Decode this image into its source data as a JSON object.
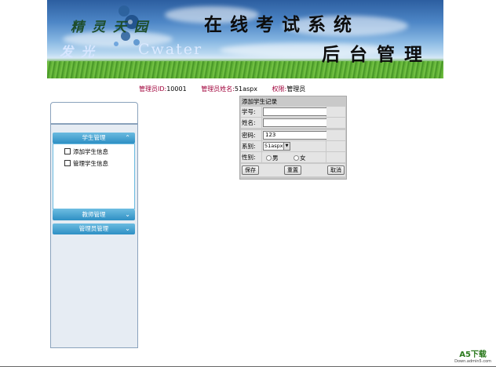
{
  "banner": {
    "logo_line1": "精灵天园",
    "logo_line2": "发光",
    "logo_cwater": "Cwater",
    "system_title": "在线考试系统",
    "system_subtitle": "后台管理"
  },
  "admin_info": {
    "id_label": "管理员ID:",
    "id_value": "10001",
    "name_label": "管理员姓名:",
    "name_value": "51aspx",
    "role_label": "权限:",
    "role_value": "管理员"
  },
  "sidebar": {
    "student_menu": {
      "title": "学生管理",
      "chevron": "up",
      "items": [
        {
          "label": "添加学生信息"
        },
        {
          "label": "管理学生信息"
        }
      ]
    },
    "teacher_menu": {
      "title": "教师管理",
      "chevron": "down"
    },
    "admin_menu": {
      "title": "管理员管理",
      "chevron": "down"
    }
  },
  "form": {
    "title": "添加学生记录",
    "student_no_label": "学号:",
    "student_no_value": "",
    "name_label": "姓名:",
    "name_value": "",
    "password_label": "密码:",
    "password_value": "123",
    "department_label": "系别:",
    "department_value": "51aspx",
    "gender_label": "性别:",
    "gender_male": "男",
    "gender_female": "女",
    "save_label": "保存",
    "reset_label": "重置",
    "cancel_label": "取消"
  },
  "watermark": {
    "main": "A5下载",
    "sub": "Down.admin5.com"
  },
  "colors": {
    "label_red": "#a0003a",
    "menu_blue": "#2e8fc4",
    "form_grey": "#c9c9c9"
  }
}
